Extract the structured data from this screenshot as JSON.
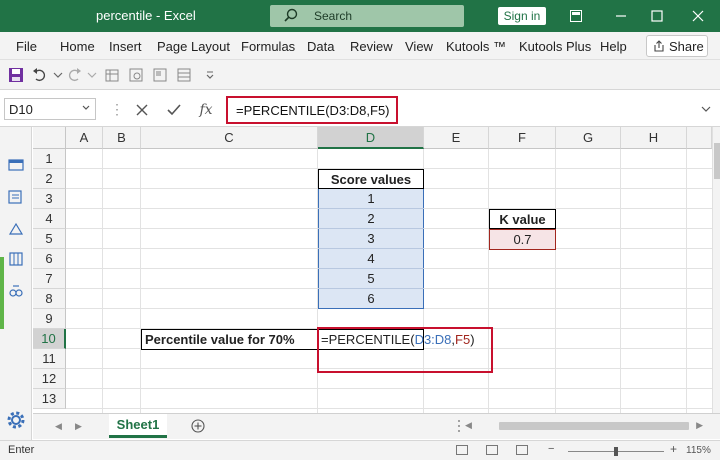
{
  "titlebar": {
    "title": "percentile  -  Excel",
    "search_label": "Search",
    "signin_label": "Sign in",
    "bg_color": "#217346"
  },
  "menu": {
    "items": [
      "File",
      "Home",
      "Insert",
      "Page Layout",
      "Formulas",
      "Data",
      "Review",
      "View",
      "Kutools ™",
      "Kutools Plus",
      "Help"
    ],
    "share_label": "Share"
  },
  "formula_bar": {
    "name_box": "D10",
    "fx_label": "fx",
    "formula": "=PERCENTILE(D3:D8,F5)"
  },
  "grid": {
    "columns": [
      "A",
      "B",
      "C",
      "D",
      "E",
      "F",
      "G",
      "H"
    ],
    "selected_column": "D",
    "rows": [
      "1",
      "2",
      "3",
      "4",
      "5",
      "6",
      "7",
      "8",
      "9",
      "10",
      "11",
      "12",
      "13"
    ],
    "selected_row": "10",
    "cells": {
      "D2": "Score values",
      "D3": "1",
      "D4": "2",
      "D5": "3",
      "D6": "4",
      "D7": "5",
      "D8": "6",
      "F4": "K value",
      "F5": "0.7",
      "C10": "Percentile value for 70%",
      "D10_prefix": "=PERCENTILE(",
      "D10_ref1": "D3:D8",
      "D10_comma": ",",
      "D10_ref2": "F5",
      "D10_suffix": ")"
    },
    "ref_colors": {
      "range": "#3a6fb8",
      "cell": "#a1261e"
    },
    "highlight_color": "#c8102e"
  },
  "sheets": {
    "tabs": [
      "Sheet1"
    ]
  },
  "status": {
    "mode": "Enter",
    "zoom": "115%"
  }
}
